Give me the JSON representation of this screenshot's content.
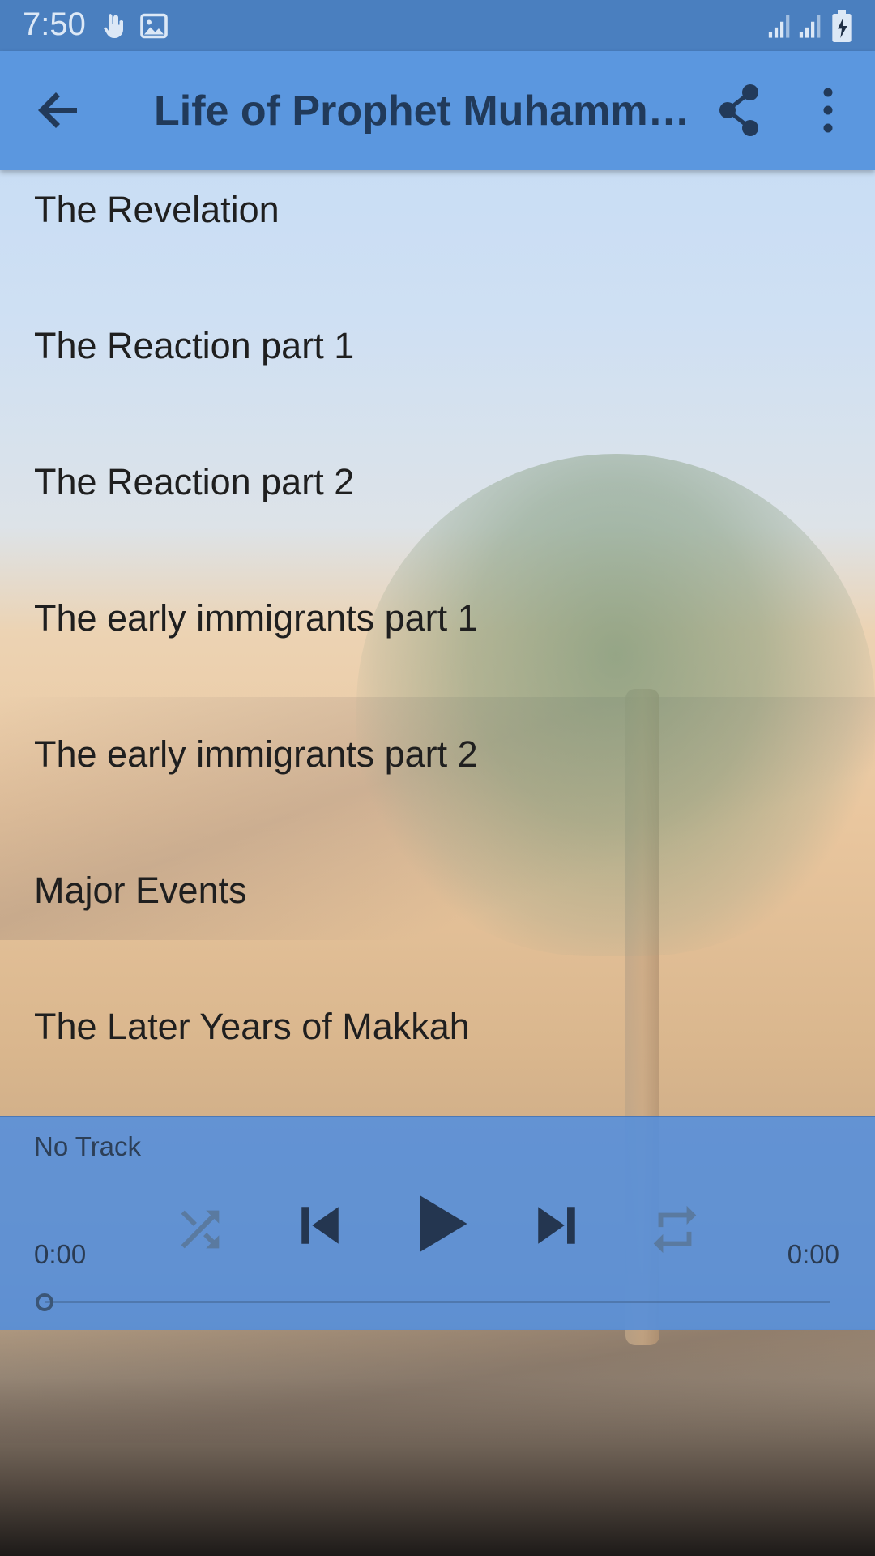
{
  "status_bar": {
    "time": "7:50",
    "icons": [
      "hand-icon",
      "image-icon",
      "signal-icon",
      "signal-icon",
      "battery-charging-icon"
    ]
  },
  "app_bar": {
    "title": "Life of Prophet Muhamm…",
    "back_icon": "arrow-back-icon",
    "share_icon": "share-icon",
    "menu_icon": "more-vert-icon",
    "background_color": "#5b97df",
    "title_color": "#213a5a"
  },
  "tracks": [
    {
      "label": "The Revelation"
    },
    {
      "label": "The Reaction part 1"
    },
    {
      "label": "The Reaction part 2"
    },
    {
      "label": "The early immigrants part 1"
    },
    {
      "label": "The early immigrants part 2"
    },
    {
      "label": "Major Events"
    },
    {
      "label": "The Later Years of Makkah"
    }
  ],
  "player": {
    "track_name": "No Track",
    "current_time": "0:00",
    "total_time": "0:00",
    "progress": 0,
    "controls": [
      "shuffle-icon",
      "skip-previous-icon",
      "play-icon",
      "skip-next-icon",
      "repeat-icon"
    ],
    "background_color": "#538edd"
  }
}
